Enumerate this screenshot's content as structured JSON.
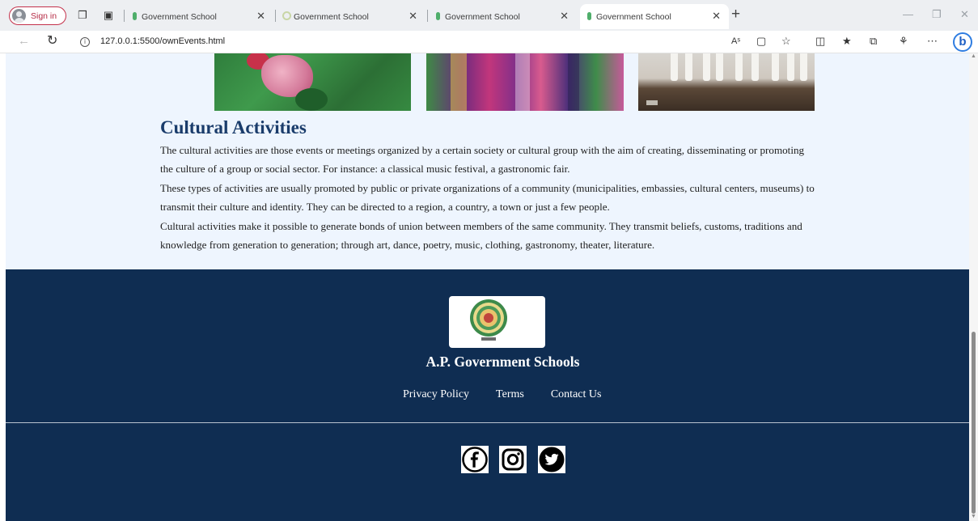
{
  "browser": {
    "signin_label": "Sign in",
    "tabs": [
      {
        "title": "Government School",
        "active": false
      },
      {
        "title": "Government School",
        "active": false
      },
      {
        "title": "Government School",
        "active": false
      },
      {
        "title": "Government School",
        "active": true
      }
    ],
    "url": "127.0.0.1:5500/ownEvents.html"
  },
  "content": {
    "title": "Cultural Activities",
    "paragraphs": [
      "The cultural activities are those events or meetings organized by a certain society or cultural group with the aim of creating, disseminating or promoting the culture of a group or social sector. For instance: a classical music festival, a gastronomic fair.",
      "These types of activities are usually promoted by public or private organizations of a community (municipalities, embassies, cultural centers, museums) to transmit their culture and identity. They can be directed to a region, a country, a town or just a few people.",
      "Cultural activities make it possible to generate bonds of union between members of the same community. They transmit beliefs, customs, traditions and knowledge from generation to generation; through art, dance, poetry, music, clothing, gastronomy, theater, literature."
    ]
  },
  "footer": {
    "org_name": "A.P. Government Schools",
    "links": {
      "privacy": "Privacy Policy",
      "terms": "Terms",
      "contact": "Contact Us"
    },
    "social": [
      "facebook-icon",
      "instagram-icon",
      "twitter-icon"
    ]
  },
  "colors": {
    "footer_bg": "#0f2d52",
    "content_bg": "#eef5fe",
    "heading": "#1a3c6b",
    "signin_accent": "#c4314b"
  }
}
